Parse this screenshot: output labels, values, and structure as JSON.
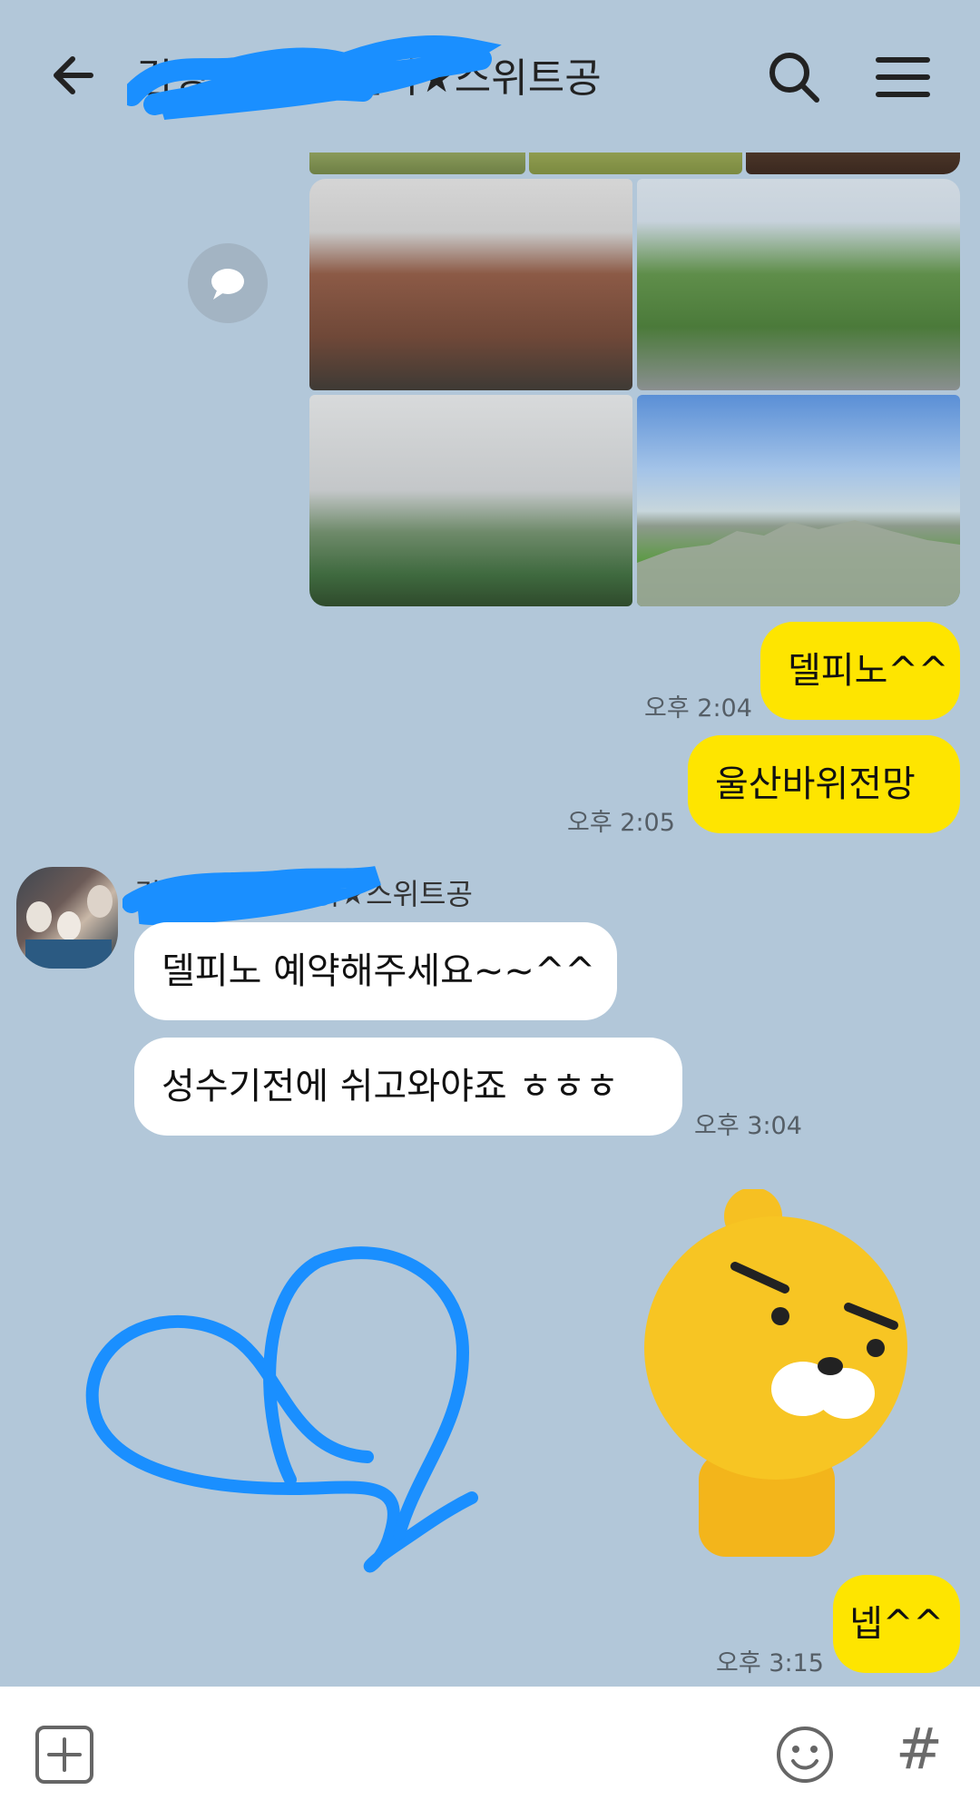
{
  "header": {
    "title": "김경희외3곳앨리★스위트공",
    "back_icon": "arrow-left-icon",
    "search_icon": "search-icon",
    "menu_icon": "hamburger-menu-icon"
  },
  "photos": {
    "share_icon": "speech-bubble-icon",
    "items": [
      "building photo",
      "park photo",
      "mountain fog photo",
      "ulsanbawi rock photo"
    ]
  },
  "messages": {
    "m1": {
      "text": "델피노^^",
      "time": "오후 2:04"
    },
    "m2": {
      "text": "울산바위전망",
      "time": "오후 2:05"
    },
    "sender_name": "김경희외3곳앨리★스위트공",
    "m3": {
      "text": "델피노 예약해주세요~~^^"
    },
    "m4": {
      "text": "성수기전에 쉬고와야죠 ㅎㅎㅎ",
      "time": "오후 3:04"
    },
    "m5": {
      "text": "넵^^",
      "time": "오후 3:15"
    }
  },
  "input_bar": {
    "attach_icon": "plus-square-icon",
    "emoji_icon": "smiley-icon",
    "hashtag_label": "#"
  },
  "colors": {
    "background": "#b2c7d9",
    "my_bubble": "#fee500",
    "other_bubble": "#ffffff",
    "scribble": "#1a8fff"
  }
}
